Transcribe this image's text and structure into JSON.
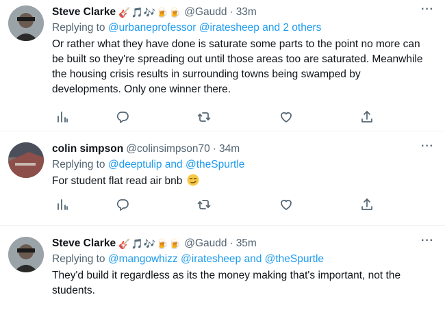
{
  "tweets": [
    {
      "name": "Steve Clarke",
      "emoji": "🎸🎵🎶🍺🍺",
      "handle": "@Gaudd",
      "dot": "·",
      "time": "33m",
      "replying_prefix": "Replying to ",
      "replying_mentions": "@urbaneprofessor @iratesheep and 2 others",
      "text": "Or rather what they have done is saturate some parts to the point no more can be built so they're spreading out until those areas too are saturated. Meanwhile the housing crisis results in surrounding towns being swamped by developments. Only one winner there."
    },
    {
      "name": "colin simpson",
      "emoji": "",
      "handle": "@colinsimpson70",
      "dot": "·",
      "time": "34m",
      "replying_prefix": "Replying to ",
      "replying_mentions": "@deeptulip and @theSpurtle",
      "text": "For student flat read air bnb"
    },
    {
      "name": "Steve Clarke",
      "emoji": "🎸🎵🎶🍺🍺",
      "handle": "@Gaudd",
      "dot": "·",
      "time": "35m",
      "replying_prefix": "Replying to ",
      "replying_mentions": "@mangowhizz @iratesheep and @theSpurtle",
      "text": "They'd build it regardless as its the money making that's important, not the students."
    }
  ],
  "more_glyph": "···",
  "colors": {
    "link": "#1d9bf0",
    "secondary": "#536471",
    "text": "#0f1419"
  }
}
